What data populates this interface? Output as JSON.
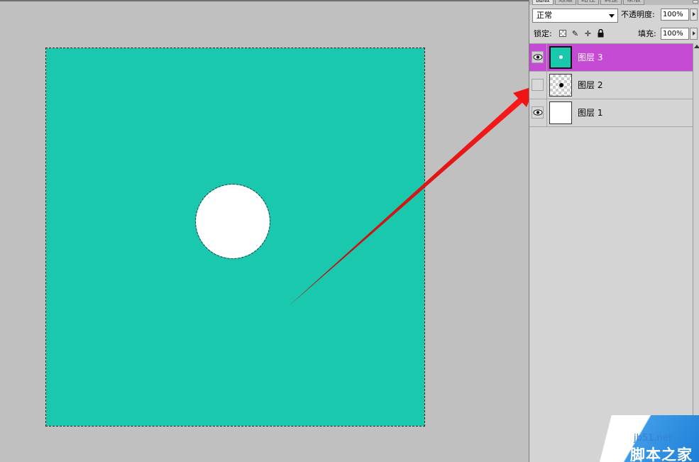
{
  "panel": {
    "tabs": [
      "图层",
      "通道",
      "路径",
      "调整",
      "蒙版"
    ],
    "blend_mode": "正常",
    "opacity_label": "不透明度:",
    "opacity_value": "100%",
    "lock_label": "锁定:",
    "fill_label": "填充:",
    "fill_value": "100%"
  },
  "layers": [
    {
      "name": "图层 3",
      "visible": true,
      "selected": true,
      "thumbnail": "teal-with-white-dot"
    },
    {
      "name": "图层 2",
      "visible": false,
      "selected": false,
      "thumbnail": "transparent-with-black-dot"
    },
    {
      "name": "图层 1",
      "visible": true,
      "selected": false,
      "thumbnail": "white"
    }
  ],
  "canvas": {
    "fill_color": "#19c8ad",
    "circle_color": "#ffffff",
    "selected_layer_color": "#c54ad4"
  },
  "annotation": {
    "arrow_color": "#e01010"
  },
  "watermark": {
    "site": "jb51.net",
    "name": "脚本之家"
  }
}
